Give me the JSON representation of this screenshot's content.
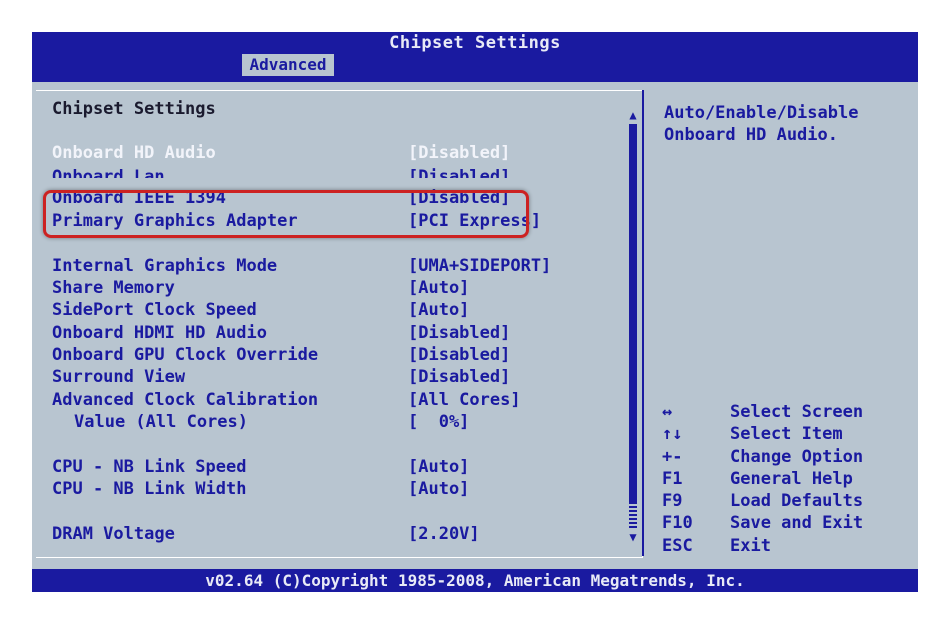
{
  "header": {
    "title": "Chipset Settings",
    "active_tab": "Advanced"
  },
  "main": {
    "section_title": "Chipset Settings",
    "rows": [
      {
        "label": "Onboard HD Audio",
        "value": "[Disabled]"
      },
      {
        "label": "Onboard Lan",
        "value": "[Disabled]"
      },
      {
        "label": "Onboard IEEE 1394",
        "value": "[Disabled]"
      },
      {
        "label": "Primary Graphics Adapter",
        "value": "[PCI Express]"
      },
      {
        "label": "Internal Graphics Mode",
        "value": "[UMA+SIDEPORT]"
      },
      {
        "label": "Share Memory",
        "value": "[Auto]"
      },
      {
        "label": "SidePort Clock Speed",
        "value": "[Auto]"
      },
      {
        "label": "Onboard HDMI HD Audio",
        "value": "[Disabled]"
      },
      {
        "label": "Onboard GPU Clock Override",
        "value": "[Disabled]"
      },
      {
        "label": "Surround View",
        "value": "[Disabled]"
      },
      {
        "label": "Advanced Clock Calibration",
        "value": "[All Cores]"
      },
      {
        "label": "Value (All Cores)",
        "value": "[  0%]"
      },
      {
        "label": "CPU - NB Link Speed",
        "value": "[Auto]"
      },
      {
        "label": "CPU - NB Link Width",
        "value": "[Auto]"
      },
      {
        "label": "DRAM Voltage",
        "value": "[2.20V]"
      }
    ]
  },
  "scrollbar": {
    "up_arrow": "▲",
    "down_arrow": "▼"
  },
  "help": {
    "description": "Auto/Enable/Disable Onboard HD Audio.",
    "keys": [
      {
        "key": "↔",
        "desc": "Select Screen"
      },
      {
        "key": "↑↓",
        "desc": "Select Item"
      },
      {
        "key": "+-",
        "desc": "Change Option"
      },
      {
        "key": "F1",
        "desc": "General Help"
      },
      {
        "key": "F9",
        "desc": "Load Defaults"
      },
      {
        "key": "F10",
        "desc": "Save and Exit"
      },
      {
        "key": "ESC",
        "desc": "Exit"
      }
    ]
  },
  "footer": {
    "text": "v02.64 (C)Copyright 1985-2008, American Megatrends, Inc."
  },
  "colors": {
    "bar_blue": "#1a1aa0",
    "background_gray": "#b8c5d0",
    "highlight_red": "#cc2222"
  }
}
